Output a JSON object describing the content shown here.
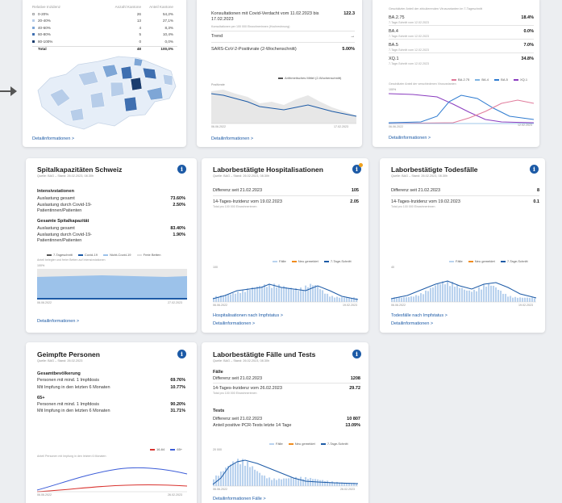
{
  "cards": {
    "top_left": {
      "table_headers": [
        "Relative Inzidenz",
        "Anzahl Kantone",
        "Anteil Kantone"
      ],
      "rows": [
        {
          "label": "0-20%",
          "count": "26",
          "pct": "54,2%",
          "color": "#e6eef8"
        },
        {
          "label": "20-40%",
          "count": "13",
          "pct": "27,1%",
          "color": "#b7cde9"
        },
        {
          "label": "40-60%",
          "count": "4",
          "pct": "8,3%",
          "color": "#7ea6d6"
        },
        {
          "label": "60-80%",
          "count": "5",
          "pct": "10,4%",
          "color": "#3f6fb0"
        },
        {
          "label": "80-100%",
          "count": "0",
          "pct": "0,0%",
          "color": "#1b3d6e"
        }
      ],
      "total_label": "Total",
      "total_count": "48",
      "total_pct": "100,0%",
      "link": "Detailinformationen >"
    },
    "top_mid": {
      "row1_label": "Konsultationen mit Covid-Verdacht vom 11.02.2023 bis 17.02.2023",
      "row1_value": "122.3",
      "row1_sub": "Konsultationen per 100 000 Einwohnerinnen (Hochrechnung)",
      "trend_label": "Trend",
      "trend_value": "→",
      "row3_label": "SARS-CoV-2-Positivrate (2-Wochenschnitt)",
      "row3_value": "5.00%",
      "legend": "Arithmetisches Mittel (2-Wochenschnitt)",
      "y_label": "Positivrate",
      "x_start": "06.06.2022",
      "x_end": "17.02.2023",
      "link": "Detailinformationen >"
    },
    "top_right": {
      "header": "Geschätzter Anteil der zirkulierenden Virusvarianten im 7-Tageschnitt",
      "variants": [
        {
          "name": "BA.2.75",
          "sub": "7-Tage-Schnitt vom 12.02.2023",
          "value": "18.4%"
        },
        {
          "name": "BA.4",
          "sub": "7-Tage-Schnitt vom 12.02.2023",
          "value": "0.0%"
        },
        {
          "name": "BA.5",
          "sub": "7-Tage-Schnitt vom 12.02.2023",
          "value": "7.0%"
        },
        {
          "name": "XQ.1",
          "sub": "7-Tage-Schnitt vom 12.02.2023",
          "value": "34.8%"
        }
      ],
      "legend": [
        "BA.2.75",
        "BA.4",
        "BA.5",
        "XQ.1"
      ],
      "chart_caption": "Geschätzter Anteil der verschiedenen Virusvarianten",
      "y_top": "100%",
      "x_start": "06.06.2022",
      "x_end": "12.02.2023",
      "link": "Detailinformationen >"
    },
    "spital": {
      "title": "Spitalkapazitäten Schweiz",
      "source": "Quelle: BAG – Stand: 26.02.2023, 08.30h",
      "sec1": "Intensivstationen",
      "r1_label": "Auslastung gesamt",
      "r1_value": "73.60%",
      "r2_label": "Auslastung durch Covid-19-Patientinnen/Patienten",
      "r2_value": "2.50%",
      "sec2": "Gesamte Spitalkapazität",
      "r3_label": "Auslastung gesamt",
      "r3_value": "83.40%",
      "r4_label": "Auslastung durch Covid-19-Patientinnen/Patienten",
      "r4_value": "1.90%",
      "legend": [
        "7-Tageschnitt",
        "Covid-19",
        "Nicht-Covid-19",
        "Freie Betten"
      ],
      "caption": "Anteil belegter und freier Betten auf Intensivstationen",
      "y_top": "100%",
      "x_start": "06.06.2022",
      "x_end": "27.02.2023",
      "link": "Detailinformationen >"
    },
    "hosp": {
      "title": "Laborbestätigte Hospitalisationen",
      "source": "Quelle: BAG – Stand: 26.02.2023, 08.30h",
      "r1_label": "Differenz seit 21.02.2023",
      "r1_value": "105",
      "r2_label": "14-Tages-Inzidenz vom 19.02.2023",
      "r2_value": "2.05",
      "r2_sub": "Total pro 100 000 Einwohnerinnen",
      "legend": [
        "Fälle",
        "Neu gemeldet",
        "7-Tage-Schnitt"
      ],
      "y_top": "100",
      "x_start": "06.06.2022",
      "x_end": "19.02.2023",
      "link1": "Hospitalisationen nach Impfstatus >",
      "link2": "Detailinformationen >"
    },
    "deaths": {
      "title": "Laborbestätigte Todesfälle",
      "source": "Quelle: BAG – Stand: 26.02.2023, 08.30h",
      "r1_label": "Differenz seit 21.02.2023",
      "r1_value": "8",
      "r2_label": "14-Tages-Inzidenz vom 19.02.2023",
      "r2_value": "0.1",
      "r2_sub": "Total pro 100 000 Einwohnerinnen",
      "legend": [
        "Fälle",
        "Neu gemeldet",
        "7-Tage-Schnitt"
      ],
      "y_top": "40",
      "x_start": "06.06.2022",
      "x_end": "19.02.2023",
      "link1": "Todesfälle nach Impfstatus >",
      "link2": "Detailinformationen >"
    },
    "vacc": {
      "title": "Geimpfte Personen",
      "source": "Quelle: BAG – Stand: 26.02.2023",
      "sec1": "Gesamtbevölkerung",
      "r1_label": "Personen mit mind. 1 Impfdosis",
      "r1_value": "69.76%",
      "r2_label": "Mit Impfung in den letzten 6 Monaten",
      "r2_value": "10.77%",
      "sec2": "65+",
      "r3_label": "Personen mit mind. 1 Impfdosis",
      "r3_value": "90.20%",
      "r4_label": "Mit Impfung in den letzten 6 Monaten",
      "r4_value": "31.71%",
      "legend": [
        "16-64",
        "65+"
      ],
      "caption": "Anteil Personen mit Impfung in den letzten 6 Monaten",
      "x_start": "06.06.2022",
      "x_end": "26.02.2023"
    },
    "cases": {
      "title": "Laborbestätigte Fälle und Tests",
      "source": "Quelle: BAG – Stand: 26.02.2023, 08.30h",
      "sec1": "Fälle",
      "r1_label": "Differenz seit 21.02.2023",
      "r1_value": "1208",
      "r2_label": "14-Tages-Inzidenz vom 26.02.2023",
      "r2_value": "29.72",
      "r2_sub": "Total pro 100 000 Einwohnerinnen",
      "sec2": "Tests",
      "r3_label": "Differenz seit 21.02.2023",
      "r3_value": "10 807",
      "r4_label": "Anteil positive PCR-Tests letzte 14 Tage",
      "r4_value": "13.09%",
      "legend": [
        "Fälle",
        "Neu gemeldet",
        "7-Tage-Schnitt"
      ],
      "y_top": "20 000",
      "x_start": "06.06.2022",
      "x_end": "26.02.2023",
      "link": "Detailinformationen Fälle >"
    }
  },
  "colors": {
    "accent": "#1c5aa6",
    "bars": "#b9d2ee",
    "line": "#1c5aa6",
    "orange": "#f08c1e"
  }
}
